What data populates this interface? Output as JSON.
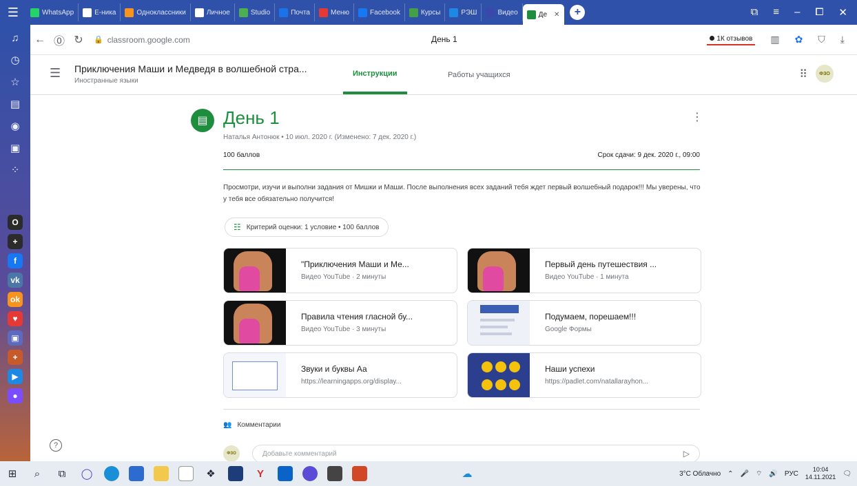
{
  "browser": {
    "tabs": [
      {
        "label": "WhatsApp",
        "color": "#25d366"
      },
      {
        "label": "Е-ника",
        "color": "#ffffff"
      },
      {
        "label": "Одноклассники",
        "color": "#f7931e"
      },
      {
        "label": "Личное",
        "color": "#ffffff"
      },
      {
        "label": "Studio",
        "color": "#4caf50"
      },
      {
        "label": "Почта",
        "color": "#1a73e8"
      },
      {
        "label": "Меню",
        "color": "#e53935"
      },
      {
        "label": "Facebook",
        "color": "#1877f2"
      },
      {
        "label": "Курсы",
        "color": "#43a047"
      },
      {
        "label": "РЭШ",
        "color": "#1e88e5"
      },
      {
        "label": "Видео",
        "color": "#3949ab"
      }
    ],
    "active_tab": {
      "label": "Дe",
      "color": "#1e8e3e"
    },
    "window_controls": [
      "⧉",
      "≡",
      "–",
      "⧠",
      "✕"
    ],
    "url": "classroom.google.com",
    "page_title": "День 1",
    "reviews_label": "1К отзывов"
  },
  "leftbar": {
    "apps": [
      {
        "label": "O",
        "color": "#2b2b2b"
      },
      {
        "label": "+",
        "color": "#2b2b2b"
      },
      {
        "label": "f",
        "color": "#1877f2"
      },
      {
        "label": "vk",
        "color": "#4a76a8"
      },
      {
        "label": "ok",
        "color": "#f7931e"
      },
      {
        "label": "♥",
        "color": "#e53935"
      },
      {
        "label": "▣",
        "color": "#5c6bc0"
      },
      {
        "label": "+",
        "color": "#c75a2b"
      },
      {
        "label": "▶",
        "color": "#1e88e5"
      },
      {
        "label": "●",
        "color": "#7c4dff"
      }
    ]
  },
  "classroom": {
    "course_name": "Приключения Маши и Медведя в волшебной стра...",
    "course_sub": "Иностранные языки",
    "tabs": [
      "Инструкции",
      "Работы учащихся"
    ],
    "avatar_text": "ФЗО"
  },
  "assignment": {
    "title": "День 1",
    "meta": "Наталья Антонюк • 10 июл. 2020 г. (Изменено: 7 дек. 2020 г.)",
    "points": "100 баллов",
    "due": "Срок сдачи: 9 дек. 2020 г., 09:00",
    "description": "Просмотри, изучи и выполни задания от Мишки и Маши. После выполнения всех заданий тебя ждет первый волшебный подарок!!! Мы уверены, что у тебя все обязательно получится!",
    "rubric": "Критерий оценки: 1 условие • 100 баллов",
    "materials": [
      {
        "title": "\"Приключения Маши и Ме...",
        "sub": "Видео YouTube · 2 минуты"
      },
      {
        "title": "Первый день путешествия ...",
        "sub": "Видео YouTube · 1 минута"
      },
      {
        "title": "Правила чтения гласной бу...",
        "sub": "Видео YouTube · 3 минуты"
      },
      {
        "title": "Подумаем, порешаем!!!",
        "sub": "Google Формы"
      },
      {
        "title": "Звуки и буквы Аа",
        "sub": "https://learningapps.org/display..."
      },
      {
        "title": "Наши успехи",
        "sub": "https://padlet.com/natallarayhon..."
      }
    ],
    "comments_label": "Комментарии",
    "comment_placeholder": "Добавьте комментарий"
  },
  "taskbar": {
    "weather": "3°C Облачно",
    "lang": "РУС",
    "time": "10:04",
    "date": "14.11.2021"
  }
}
